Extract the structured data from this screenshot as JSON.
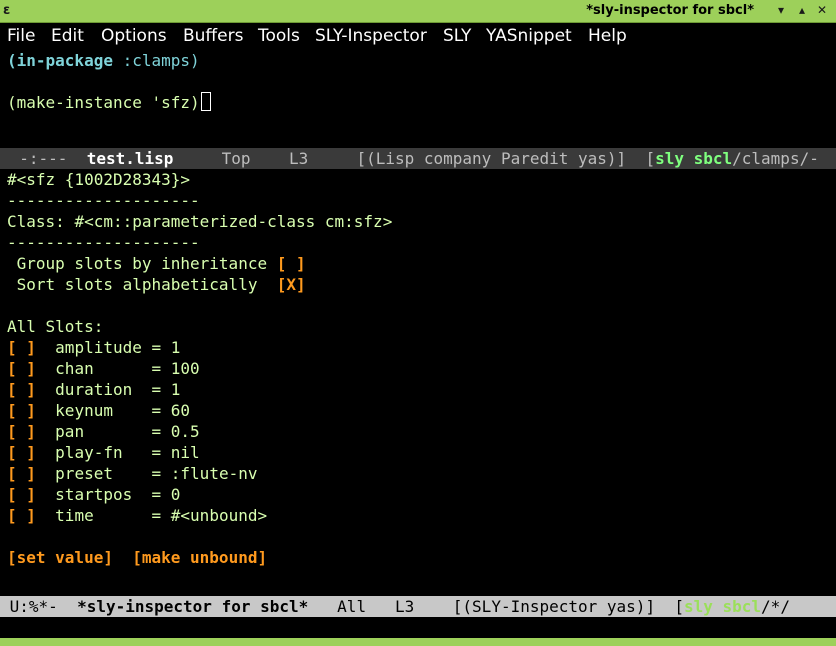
{
  "window": {
    "title": "*sly-inspector for sbcl*",
    "icon": "emacs-icon"
  },
  "menu": [
    "File",
    "Edit",
    "Options",
    "Buffers",
    "Tools",
    "SLY-Inspector",
    "SLY",
    "YASnippet",
    "Help"
  ],
  "editor": {
    "line1_kw": "(in-package",
    "line1_sym": " :clamps)",
    "line2": "(make-instance 'sfz)"
  },
  "modeline1": {
    "state": "-:---",
    "buffer": "test.lisp",
    "position": "Top",
    "line": "L3",
    "modes": "[(Lisp company Paredit yas)]",
    "sly_prefix": "[",
    "sly": "sly sbcl",
    "sly_suffix": "/clamps/-"
  },
  "inspector": {
    "object": "#<sfz {1002D28343}>",
    "separator": "--------------------",
    "class_label": "Class: ",
    "class_value": "#<cm::parameterized-class cm:sfz>",
    "group_label": " Group slots by inheritance ",
    "group_box": "[ ]",
    "sort_label": " Sort slots alphabetically  ",
    "sort_box": "[X]",
    "all_slots": "All Slots:",
    "slots": [
      {
        "box": "[ ]",
        "name": "amplitude",
        "pad": " = ",
        "value": "1"
      },
      {
        "box": "[ ]",
        "name": "chan     ",
        "pad": " = ",
        "value": "100"
      },
      {
        "box": "[ ]",
        "name": "duration ",
        "pad": " = ",
        "value": "1"
      },
      {
        "box": "[ ]",
        "name": "keynum   ",
        "pad": " = ",
        "value": "60"
      },
      {
        "box": "[ ]",
        "name": "pan      ",
        "pad": " = ",
        "value": "0.5"
      },
      {
        "box": "[ ]",
        "name": "play-fn  ",
        "pad": " = ",
        "value": "nil"
      },
      {
        "box": "[ ]",
        "name": "preset   ",
        "pad": " = ",
        "value": ":flute-nv"
      },
      {
        "box": "[ ]",
        "name": "startpos ",
        "pad": " = ",
        "value": "0"
      },
      {
        "box": "[ ]",
        "name": "time     ",
        "pad": " = ",
        "value": "#<unbound>"
      }
    ],
    "set_value": "[set value]",
    "make_unbound": "[make unbound]"
  },
  "modeline2": {
    "state": "U:%*-",
    "buffer": "*sly-inspector for sbcl*",
    "position": "All",
    "line": "L3",
    "modes": "[(SLY-Inspector yas)]",
    "sly_prefix": "[",
    "sly": "sly sbcl",
    "sly_suffix": "/*/"
  }
}
